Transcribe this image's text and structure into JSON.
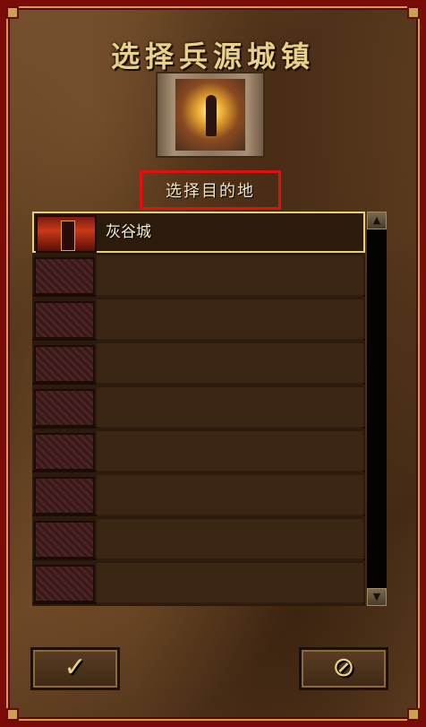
{
  "title": "选择兵源城镇",
  "subtitle": "选择目的地",
  "towns": [
    {
      "name": "灰谷城",
      "selected": true
    },
    {
      "name": "",
      "selected": false
    },
    {
      "name": "",
      "selected": false
    },
    {
      "name": "",
      "selected": false
    },
    {
      "name": "",
      "selected": false
    },
    {
      "name": "",
      "selected": false
    },
    {
      "name": "",
      "selected": false
    },
    {
      "name": "",
      "selected": false
    },
    {
      "name": "",
      "selected": false
    }
  ],
  "buttons": {
    "ok_symbol": "✓",
    "cancel_symbol": "⊘"
  },
  "scrollbar": {
    "up_symbol": "▲",
    "down_symbol": "▼"
  },
  "colors": {
    "frame": "#7a0c08",
    "gold": "#e8cf8a",
    "highlight_box": "#e01010"
  }
}
